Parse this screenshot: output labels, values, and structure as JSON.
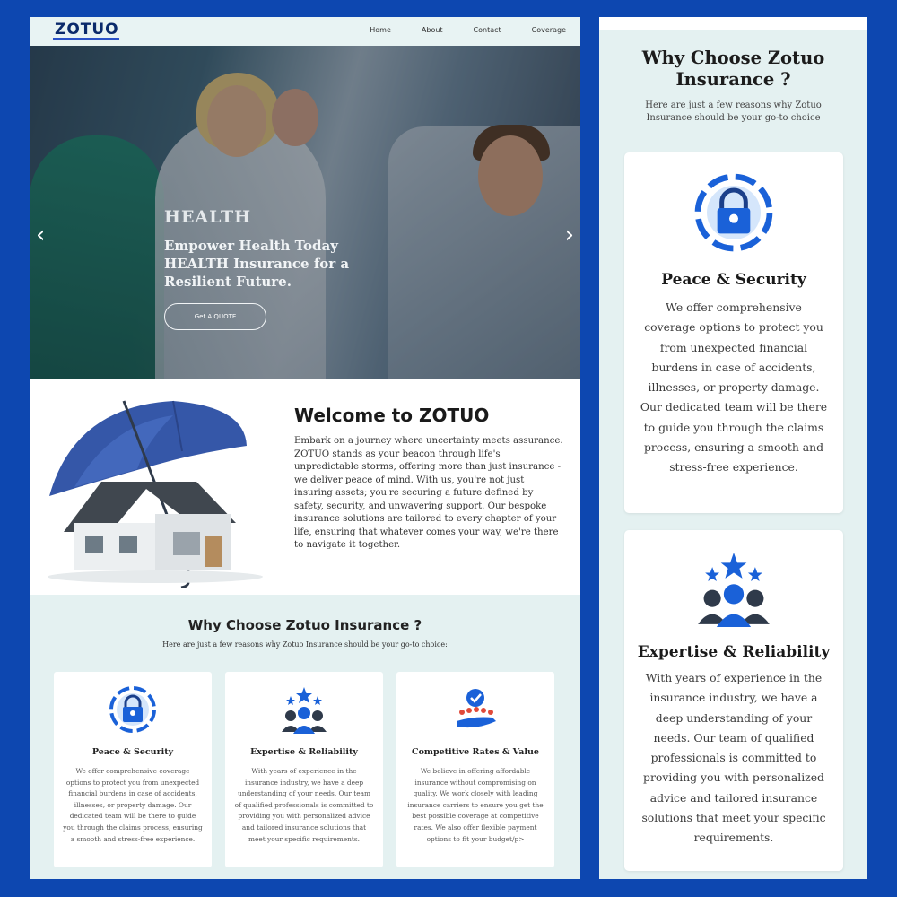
{
  "nav": {
    "logo": "ZOTUO",
    "links": [
      "Home",
      "About",
      "Contact",
      "Coverage"
    ]
  },
  "hero": {
    "kicker": "HEALTH",
    "title": "Empower Health Today HEALTH Insurance for a Resilient Future.",
    "button": "Get A QUOTE",
    "prev_icon": "‹",
    "next_icon": "›",
    "slides_total": 3,
    "active_slide": 2
  },
  "welcome": {
    "title": "Welcome to ZOTUO",
    "body": "Embark on a journey where uncertainty meets assurance. ZOTUO stands as your beacon through life's unpredictable storms, offering more than just insurance - we deliver peace of mind. With us, you're not just insuring assets; you're securing a future defined by safety, security, and unwavering support. Our bespoke insurance solutions are tailored to every chapter of your life, ensuring that whatever comes your way, we're there to navigate it together."
  },
  "why": {
    "title": "Why Choose Zotuo Insurance ?",
    "subtitle": "Here are just a few reasons why Zotuo Insurance should be your go-to choice:",
    "cards": [
      {
        "icon": "lock-shield-icon",
        "title": "Peace & Security",
        "text": "We offer comprehensive coverage options to protect you from unexpected financial burdens in case of accidents, illnesses, or property damage. Our dedicated team will be there to guide you through the claims process, ensuring a smooth and stress-free experience."
      },
      {
        "icon": "team-stars-icon",
        "title": "Expertise & Reliability",
        "text": "With years of experience in the insurance industry, we have a deep understanding of your needs. Our team of qualified professionals is committed to providing you with personalized advice and tailored insurance solutions that meet your specific requirements."
      },
      {
        "icon": "hand-rating-icon",
        "title": "Competitive Rates & Value",
        "text": "We believe in offering affordable insurance without compromising on quality. We work closely with leading insurance carriers to ensure you get the best possible coverage at competitive rates. We also offer flexible payment options to fit your budget/p>"
      }
    ]
  },
  "mobile": {
    "title": "Why Choose Zotuo Insurance ?",
    "subtitle": "Here are just a few reasons why Zotuo Insurance should be your go-to choice",
    "cards": [
      {
        "icon": "lock-shield-icon",
        "title": "Peace & Security",
        "text": "We offer comprehensive coverage options to protect you from unexpected financial burdens in case of accidents, illnesses, or property damage. Our dedicated team will be there to guide you through the claims process, ensuring a smooth and stress-free experience."
      },
      {
        "icon": "team-stars-icon",
        "title": "Expertise & Reliability",
        "text": "With years of experience in the insurance industry, we have a deep understanding of your needs. Our team of qualified professionals is committed to providing you with personalized advice and tailored insurance solutions that meet your specific requirements."
      }
    ]
  },
  "colors": {
    "frame": "#0d47b0",
    "panel": "#e4f1f1",
    "brand": "#0b2a6b",
    "icon_blue": "#1a61d8"
  }
}
